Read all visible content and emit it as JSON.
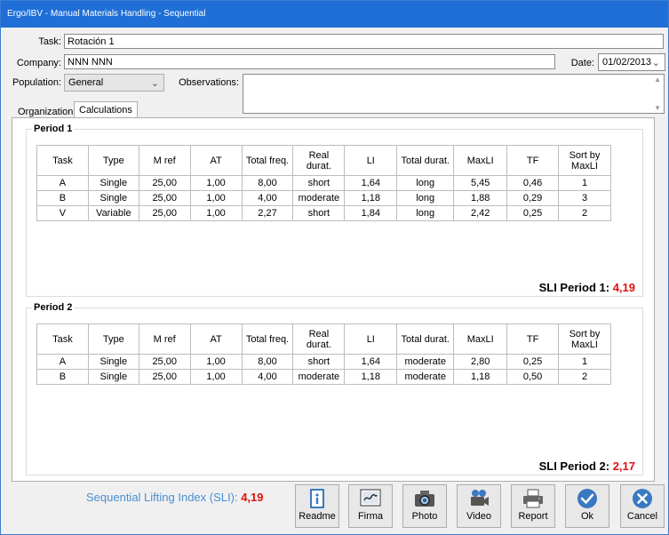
{
  "window": {
    "title": "Ergo/IBV - Manual Materials Handling - Sequential"
  },
  "form": {
    "task_label": "Task:",
    "task_value": "Rotación 1",
    "company_label": "Company:",
    "company_value": "NNN NNN",
    "date_label": "Date:",
    "date_value": "01/02/2013",
    "population_label": "Population:",
    "population_value": "General",
    "observations_label": "Observations:",
    "observations_value": ""
  },
  "tabs": [
    {
      "label": "Organization",
      "active": false
    },
    {
      "label": "Calculations",
      "active": true
    }
  ],
  "columns": [
    "Task",
    "Type",
    "M ref",
    "AT",
    "Total freq.",
    "Real durat.",
    "LI",
    "Total durat.",
    "MaxLI",
    "TF",
    "Sort by MaxLI"
  ],
  "periods": [
    {
      "title": "Period 1",
      "rows": [
        [
          "A",
          "Single",
          "25,00",
          "1,00",
          "8,00",
          "short",
          "1,64",
          "long",
          "5,45",
          "0,46",
          "1"
        ],
        [
          "B",
          "Single",
          "25,00",
          "1,00",
          "4,00",
          "moderate",
          "1,18",
          "long",
          "1,88",
          "0,29",
          "3"
        ],
        [
          "V",
          "Variable",
          "25,00",
          "1,00",
          "2,27",
          "short",
          "1,84",
          "long",
          "2,42",
          "0,25",
          "2"
        ]
      ],
      "sli_label": "SLI Period 1:",
      "sli_value": "4,19"
    },
    {
      "title": "Period 2",
      "rows": [
        [
          "A",
          "Single",
          "25,00",
          "1,00",
          "8,00",
          "short",
          "1,64",
          "moderate",
          "2,80",
          "0,25",
          "1"
        ],
        [
          "B",
          "Single",
          "25,00",
          "1,00",
          "4,00",
          "moderate",
          "1,18",
          "moderate",
          "1,18",
          "0,50",
          "2"
        ]
      ],
      "sli_label": "SLI Period 2:",
      "sli_value": "2,17"
    }
  ],
  "summary": {
    "label": "Sequential Lifting Index (SLI):",
    "value": "4,19"
  },
  "buttons": {
    "readme": "Readme",
    "firma": "Firma",
    "photo": "Photo",
    "video": "Video",
    "report": "Report",
    "ok": "Ok",
    "cancel": "Cancel"
  },
  "colors": {
    "accent": "#1f6fd6",
    "sli_value": "#e01010",
    "summary_label": "#4a8fd0"
  }
}
